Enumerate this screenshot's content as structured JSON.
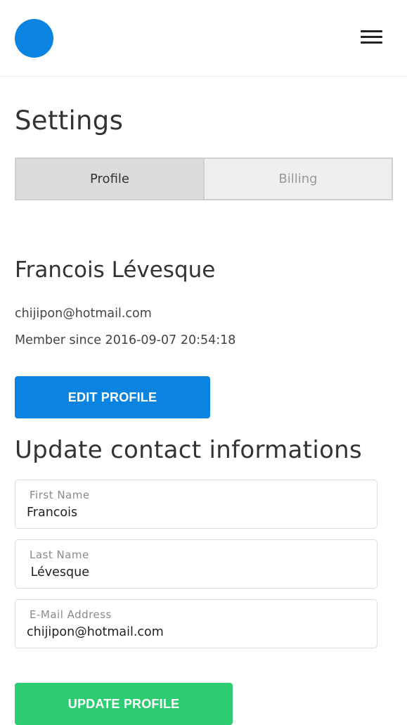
{
  "header": {
    "logo_icon": "circle-logo",
    "menu_icon": "hamburger-menu-icon",
    "accent_color": "#0a84e0"
  },
  "page": {
    "title": "Settings"
  },
  "tabs": [
    {
      "label": "Profile",
      "active": true
    },
    {
      "label": "Billing",
      "active": false
    }
  ],
  "profile": {
    "name": "Francois Lévesque",
    "email": "chijipon@hotmail.com",
    "member_since": "Member since 2016-09-07 20:54:18",
    "edit_button_label": "EDIT PROFILE"
  },
  "contact_form": {
    "title": "Update contact informations",
    "fields": [
      {
        "label": "First Name",
        "value": "Francois"
      },
      {
        "label": "Last Name",
        "value": " Lévesque"
      },
      {
        "label": "E-Mail Address",
        "value": "chijipon@hotmail.com"
      }
    ],
    "submit_label": "UPDATE PROFILE",
    "submit_color": "#2ecc71"
  }
}
